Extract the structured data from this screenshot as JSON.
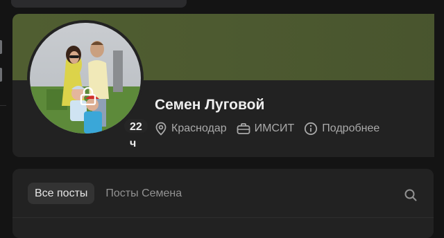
{
  "profile": {
    "name": "Семен Луговой",
    "last_seen": "22 ч",
    "city": "Краснодар",
    "university": "ИМСИТ",
    "details_link": "Подробнее"
  },
  "posts": {
    "tabs": [
      {
        "label": "Все посты",
        "active": true
      },
      {
        "label": "Посты Семена",
        "active": false
      }
    ]
  },
  "icons": {
    "lock": "lock-icon",
    "location": "location-pin-icon",
    "education": "briefcase-icon",
    "info": "info-circle-icon",
    "search": "search-icon"
  },
  "colors": {
    "background": "#141414",
    "card": "#222222",
    "cover": "#4d5a30",
    "active_tab": "#333333",
    "muted_text": "#aaaaaa"
  }
}
